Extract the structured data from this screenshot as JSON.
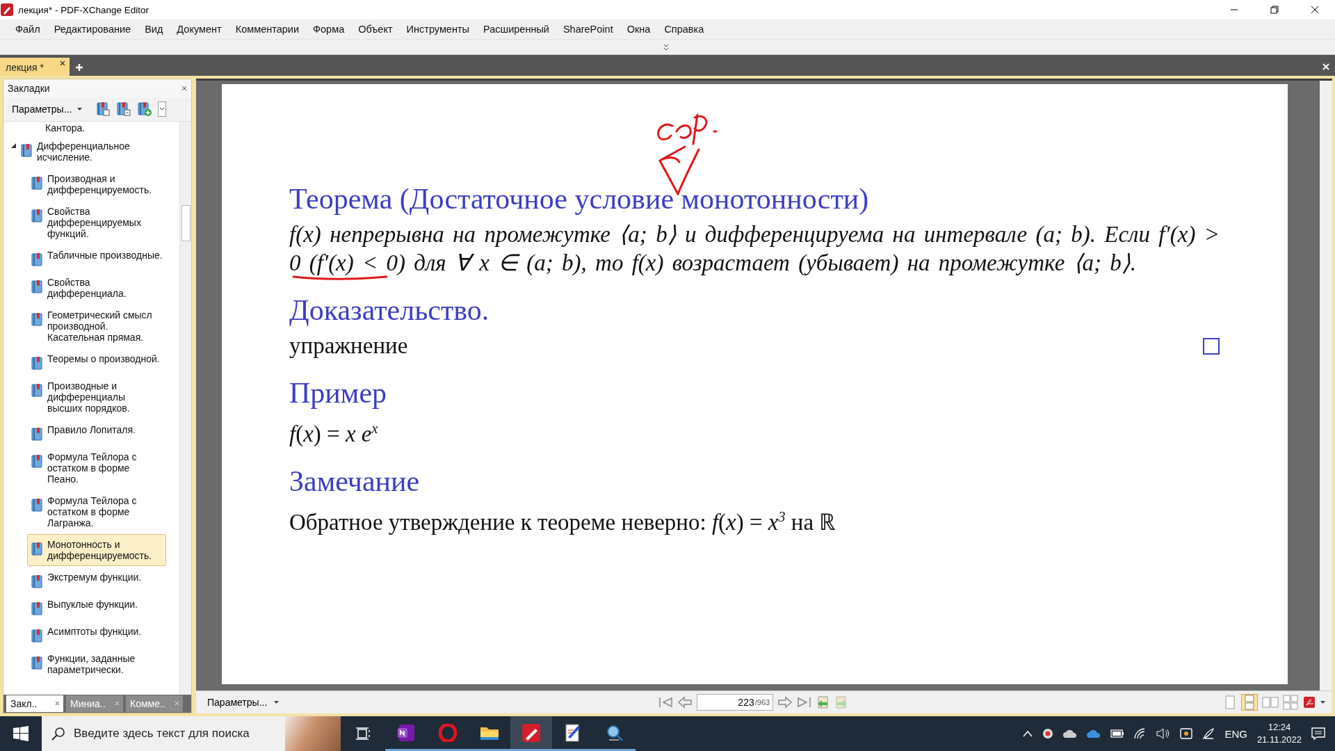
{
  "window": {
    "title": "лекция* - PDF-XChange Editor"
  },
  "menu": [
    "Файл",
    "Редактирование",
    "Вид",
    "Документ",
    "Комментарии",
    "Форма",
    "Объект",
    "Инструменты",
    "Расширенный",
    "SharePoint",
    "Окна",
    "Справка"
  ],
  "tabs": [
    {
      "label": "лекция *",
      "selected": true
    }
  ],
  "bookmarks_panel": {
    "title": "Закладки",
    "options_button": "Параметры...",
    "items": [
      {
        "label": "Кантора.",
        "kind": "cut"
      },
      {
        "label": "Дифференциальное исчисление.",
        "kind": "node",
        "expanded": true,
        "selected": false,
        "children": [
          {
            "label": "Производная и дифференцируемость.",
            "selected": false
          },
          {
            "label": "Свойства дифференцируемых функций.",
            "selected": false
          },
          {
            "label": "Табличные производные.",
            "selected": false
          },
          {
            "label": "Свойства дифференциала.",
            "selected": false
          },
          {
            "label": "Геометрический смысл производной. Касательная прямая.",
            "selected": false
          },
          {
            "label": "Теоремы о производной.",
            "selected": false
          },
          {
            "label": "Производные и дифференциалы высших порядков.",
            "selected": false
          },
          {
            "label": "Правило Лопиталя.",
            "selected": false
          },
          {
            "label": "Формула Тейлора с остатком в форме Пеано.",
            "selected": false
          },
          {
            "label": "Формула Тейлора с остатком в форме Лагранжа.",
            "selected": false
          },
          {
            "label": "Монотонность и дифференцируемость.",
            "selected": true
          },
          {
            "label": "Экстремум функции.",
            "selected": false
          },
          {
            "label": "Выпуклые функции.",
            "selected": false
          },
          {
            "label": "Асимптоты функции.",
            "selected": false
          },
          {
            "label": "Функции, заданные параметрически.",
            "selected": false
          }
        ]
      }
    ]
  },
  "panel_tabs": [
    {
      "label": "Закл..",
      "selected": true
    },
    {
      "label": "Миниа..",
      "selected": false
    },
    {
      "label": "Комме..",
      "selected": false
    }
  ],
  "page": {
    "blocks": [
      {
        "kind": "heading",
        "text": "Теорема (Достаточное условие монотонности)"
      },
      {
        "kind": "statement",
        "text": "f(x) непрерывна на промежутке ⟨a; b⟩ и дифференцируема на интервале (a; b). Если f′(x) > 0 (f′(x) < 0) для ∀ x ∈ (a; b), то f(x) возрастает (убывает) на промежутке ⟨a; b⟩."
      },
      {
        "kind": "heading",
        "text": "Доказательство."
      },
      {
        "kind": "proof",
        "text": "упражнение"
      },
      {
        "kind": "heading",
        "text": "Пример"
      },
      {
        "kind": "formula",
        "text": "*f*(*x*) = *x e*$^{x}$"
      },
      {
        "kind": "heading",
        "text": "Замечание"
      },
      {
        "kind": "text",
        "text": "Обратное утверждение к теореме неверно: *f*(*x*) = *x*$^{3}$ на ℝ"
      }
    ]
  },
  "doc_toolbar": {
    "options_button": "Параметры...",
    "page": "223",
    "page_count": "/963"
  },
  "taskbar": {
    "search_placeholder": "Введите здесь текст для поиска",
    "apps": [
      {
        "kind": "notes",
        "selected": false
      },
      {
        "kind": "browser",
        "selected": false
      },
      {
        "kind": "folder",
        "selected": false
      },
      {
        "kind": "pdf-editor",
        "selected": true
      },
      {
        "kind": "drawing-tool",
        "selected": false
      },
      {
        "kind": "satellite-tool",
        "selected": false
      }
    ],
    "language": "ENG",
    "time": "12:24",
    "date": "21.11.2022"
  }
}
